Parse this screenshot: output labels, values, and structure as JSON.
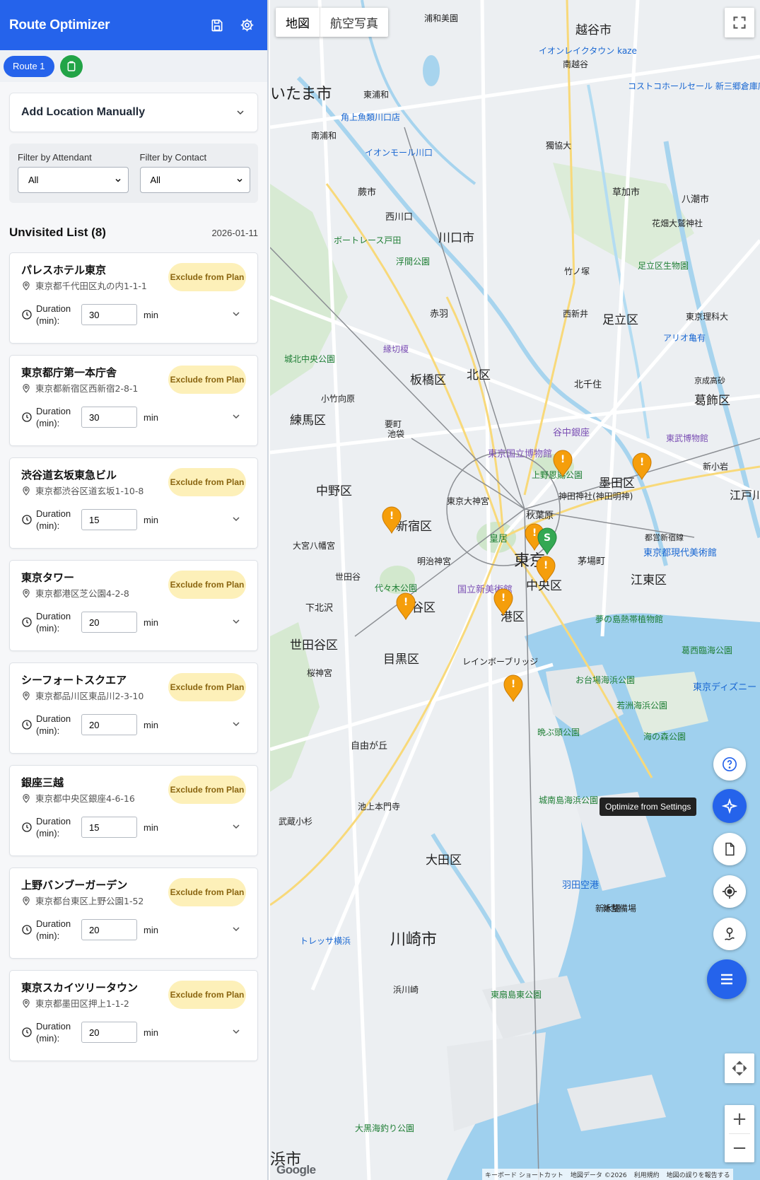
{
  "app": {
    "title": "Route Optimizer",
    "colors": {
      "primary": "#2563eb",
      "add_route": "#22a447",
      "marker": "#f59e0b",
      "start_marker": "#34a853"
    }
  },
  "header": {
    "save_icon": "save-icon",
    "settings_icon": "gear-icon"
  },
  "routes": {
    "tabs": [
      {
        "label": "Route 1"
      }
    ],
    "add_icon": "clipboard-add-icon"
  },
  "add_location": {
    "label": "Add Location Manually"
  },
  "filters": {
    "attendant": {
      "label": "Filter by Attendant",
      "value": "All"
    },
    "contact": {
      "label": "Filter by Contact",
      "value": "All"
    }
  },
  "list": {
    "title": "Unvisited List (8)",
    "date": "2026-01-11",
    "exclude_label": "Exclude from Plan",
    "duration_label": "Duration (min):",
    "unit": "min",
    "items": [
      {
        "name": "パレスホテル東京",
        "address": "東京都千代田区丸の内1-1-1",
        "duration": "30"
      },
      {
        "name": "東京都庁第一本庁舎",
        "address": "東京都新宿区西新宿2-8-1",
        "duration": "30"
      },
      {
        "name": "渋谷道玄坂東急ビル",
        "address": "東京都渋谷区道玄坂1-10-8",
        "duration": "15"
      },
      {
        "name": "東京タワー",
        "address": "東京都港区芝公園4-2-8",
        "duration": "20"
      },
      {
        "name": "シーフォートスクエア",
        "address": "東京都品川区東品川2-3-10",
        "duration": "20"
      },
      {
        "name": "銀座三越",
        "address": "東京都中央区銀座4-6-16",
        "duration": "15"
      },
      {
        "name": "上野バンブーガーデン",
        "address": "東京都台東区上野公園1-52",
        "duration": "20"
      },
      {
        "name": "東京スカイツリータウン",
        "address": "東京都墨田区押上1-1-2",
        "duration": "20"
      }
    ]
  },
  "map": {
    "type_buttons": [
      {
        "label": "地図"
      },
      {
        "label": "航空写真"
      }
    ],
    "tooltip": "Optimize from Settings",
    "logo": "Google",
    "attribution": [
      "キーボード ショートカット",
      "地図データ ©2026",
      "利用規約",
      "地図の誤りを報告する"
    ],
    "zoom_in": "+",
    "zoom_out": "−",
    "start_label": "S",
    "alert_label": "!",
    "places": [
      {
        "name": "いたま市",
        "kind": "city"
      },
      {
        "name": "越谷市",
        "kind": "city"
      },
      {
        "name": "川口市",
        "kind": "city"
      },
      {
        "name": "足立区",
        "kind": "ward"
      },
      {
        "name": "板橋区",
        "kind": "ward"
      },
      {
        "name": "北区",
        "kind": "ward"
      },
      {
        "name": "葛飾区",
        "kind": "ward"
      },
      {
        "name": "練馬区",
        "kind": "ward"
      },
      {
        "name": "中野区",
        "kind": "ward"
      },
      {
        "name": "新宿区",
        "kind": "ward"
      },
      {
        "name": "墨田区",
        "kind": "ward"
      },
      {
        "name": "東京",
        "kind": "city"
      },
      {
        "name": "中央区",
        "kind": "ward"
      },
      {
        "name": "江東区",
        "kind": "ward"
      },
      {
        "name": "谷区",
        "kind": "ward"
      },
      {
        "name": "港区",
        "kind": "ward"
      },
      {
        "name": "世田谷区",
        "kind": "ward"
      },
      {
        "name": "目黒区",
        "kind": "ward"
      },
      {
        "name": "大田区",
        "kind": "ward"
      },
      {
        "name": "川崎市",
        "kind": "city"
      },
      {
        "name": "江戸川",
        "kind": "ward"
      },
      {
        "name": "浜市",
        "kind": "city"
      },
      {
        "name": "八潮市",
        "kind": "small"
      },
      {
        "name": "草加市",
        "kind": "small"
      },
      {
        "name": "蕨市",
        "kind": "small"
      },
      {
        "name": "西川口",
        "kind": "small"
      },
      {
        "name": "赤羽",
        "kind": "small"
      },
      {
        "name": "北千住",
        "kind": "small"
      },
      {
        "name": "秋葉原",
        "kind": "small"
      },
      {
        "name": "茅場町",
        "kind": "small"
      },
      {
        "name": "自由が丘",
        "kind": "small"
      },
      {
        "name": "下北沢",
        "kind": "small"
      },
      {
        "name": "浦和美園",
        "kind": "small"
      },
      {
        "name": "南越谷",
        "kind": "small"
      },
      {
        "name": "東浦和",
        "kind": "small"
      },
      {
        "name": "南浦和",
        "kind": "small"
      },
      {
        "name": "獨協大",
        "kind": "small"
      },
      {
        "name": "新木場",
        "kind": "small"
      },
      {
        "name": "羽田空港",
        "kind": "poi"
      },
      {
        "name": "新整備場",
        "kind": "small"
      },
      {
        "name": "東京都現代美術館",
        "kind": "poi"
      },
      {
        "name": "東京国立博物館",
        "kind": "poi"
      },
      {
        "name": "谷中銀座",
        "kind": "poi"
      },
      {
        "name": "国立新美術館",
        "kind": "poi"
      },
      {
        "name": "明治神宮",
        "kind": "small"
      },
      {
        "name": "代々木公園",
        "kind": "park"
      },
      {
        "name": "上野恩賜公園",
        "kind": "park"
      },
      {
        "name": "皇居",
        "kind": "park"
      },
      {
        "name": "お台場海浜公園",
        "kind": "park"
      },
      {
        "name": "若洲海浜公園",
        "kind": "park"
      },
      {
        "name": "海の森公園",
        "kind": "park"
      },
      {
        "name": "城南島海浜公園",
        "kind": "park"
      },
      {
        "name": "葛西臨海公園",
        "kind": "park"
      },
      {
        "name": "東京ディズニー",
        "kind": "poi"
      },
      {
        "name": "夢の島熱帯植物館",
        "kind": "park"
      },
      {
        "name": "足立区生物園",
        "kind": "park"
      },
      {
        "name": "東武博物館",
        "kind": "poi"
      },
      {
        "name": "アリオ亀有",
        "kind": "poi"
      },
      {
        "name": "イオンレイクタウン kaze",
        "kind": "poi"
      },
      {
        "name": "コストコホールセール 新三郷倉庫店",
        "kind": "poi"
      },
      {
        "name": "角上魚類川口店",
        "kind": "poi"
      },
      {
        "name": "イオンモール川口",
        "kind": "poi"
      },
      {
        "name": "ボートレース戸田",
        "kind": "park"
      },
      {
        "name": "浮間公園",
        "kind": "park"
      },
      {
        "name": "城北中央公園",
        "kind": "park"
      },
      {
        "name": "縁切榎",
        "kind": "poi"
      },
      {
        "name": "東京大神宮",
        "kind": "small"
      },
      {
        "name": "大宮八幡宮",
        "kind": "small"
      },
      {
        "name": "神田神社(神田明神)",
        "kind": "small"
      },
      {
        "name": "都営新宿線",
        "kind": "small"
      },
      {
        "name": "レインボーブリッジ",
        "kind": "small"
      },
      {
        "name": "池上本門寺",
        "kind": "small"
      },
      {
        "name": "晩ぶ頭公園",
        "kind": "park"
      },
      {
        "name": "東扇島東公園",
        "kind": "park"
      },
      {
        "name": "トレッサ横浜",
        "kind": "poi"
      },
      {
        "name": "大黒海釣り公園",
        "kind": "park"
      },
      {
        "name": "武蔵小杉",
        "kind": "small"
      },
      {
        "name": "浜川崎",
        "kind": "small"
      },
      {
        "name": "花畑大鷲神社",
        "kind": "small"
      },
      {
        "name": "東京理科大",
        "kind": "small"
      },
      {
        "name": "要町",
        "kind": "small"
      },
      {
        "name": "池袋",
        "kind": "small"
      },
      {
        "name": "小竹向原",
        "kind": "small"
      },
      {
        "name": "世田谷",
        "kind": "small"
      },
      {
        "name": "桜神宮",
        "kind": "small"
      },
      {
        "name": "新小岩",
        "kind": "small"
      },
      {
        "name": "京成高砂",
        "kind": "small"
      },
      {
        "name": "竹ノ塚",
        "kind": "small"
      },
      {
        "name": "西新井",
        "kind": "small"
      }
    ]
  }
}
